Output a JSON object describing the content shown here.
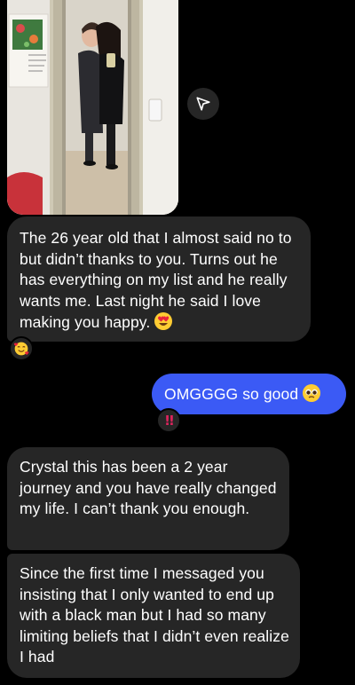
{
  "thread": {
    "photo": {
      "description_icon": "mirror-selfie-photo"
    },
    "share_icon": "paper-plane-icon",
    "messages": [
      {
        "direction": "incoming",
        "text": "The 26 year old that I almost said no to but didn’t thanks to you. Turns out he has everything on my list and he really wants me. Last night he said I love making you happy.",
        "trailing_emoji": "heart-eyes-emoji",
        "reaction": "smiling-face-with-hearts-emoji"
      },
      {
        "direction": "outgoing",
        "text": "OMGGGG so good",
        "trailing_emoji": "pleading-face-emoji",
        "reaction": "!!"
      },
      {
        "direction": "incoming",
        "text": "Crystal this has been a 2 year journey and you have really changed my life. I can’t thank you enough."
      },
      {
        "direction": "incoming",
        "text": "Since the first time I messaged you insisting that I only wanted to end up with a black man but I had so many limiting beliefs that I didn’t even realize I had"
      }
    ]
  },
  "colors": {
    "background": "#000000",
    "incoming_bubble": "#262626",
    "outgoing_bubble": "#3b5af5",
    "reaction_red": "#e0245e"
  }
}
